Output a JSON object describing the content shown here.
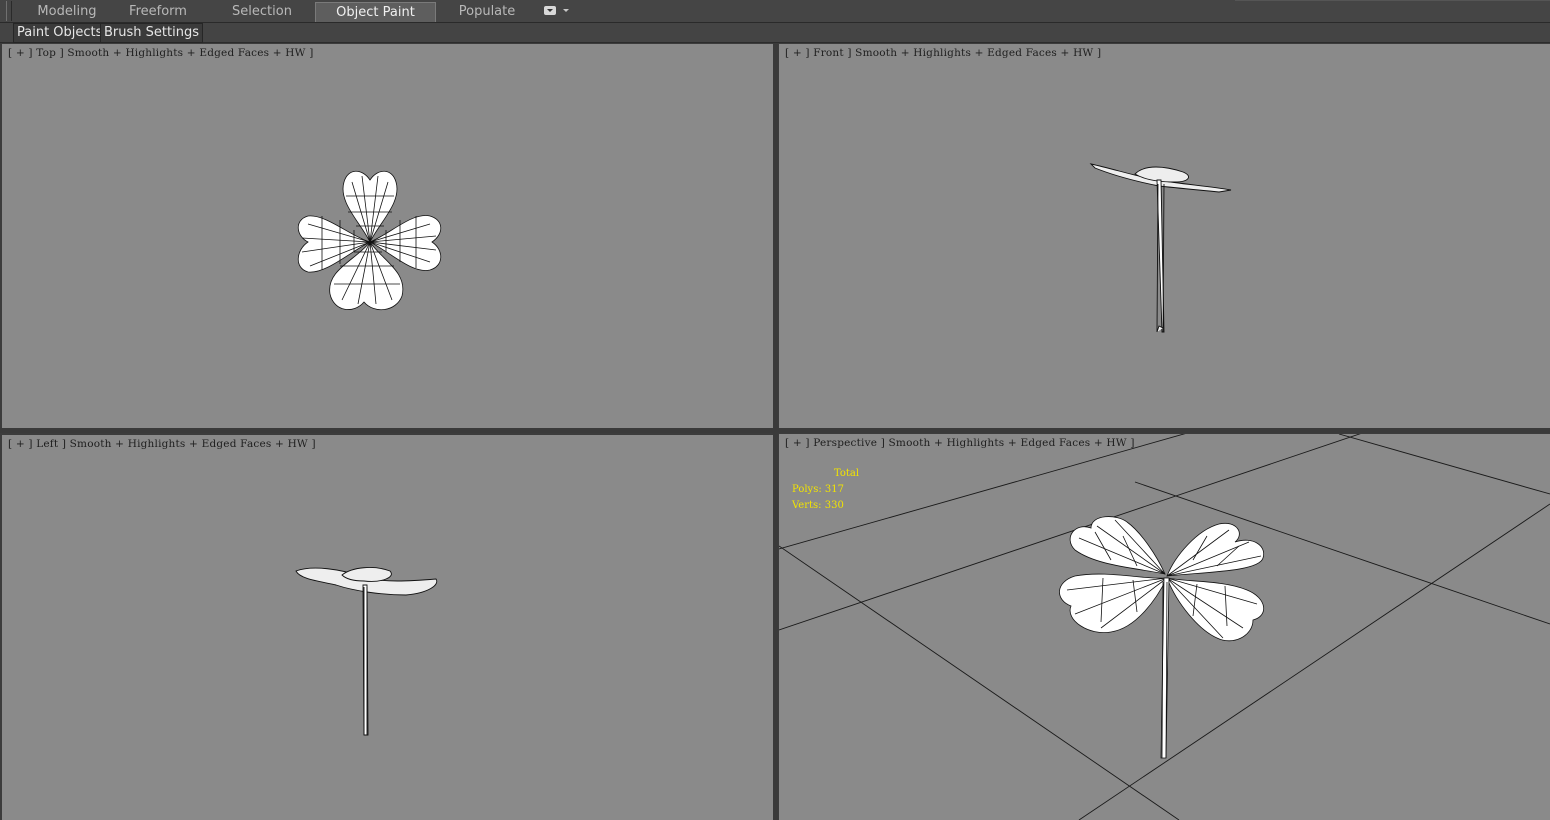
{
  "ribbon": {
    "tabs": [
      {
        "label": "Modeling",
        "active": false
      },
      {
        "label": "Freeform",
        "active": false
      },
      {
        "label": "Selection",
        "active": false
      },
      {
        "label": "Object Paint",
        "active": true
      },
      {
        "label": "Populate",
        "active": false
      }
    ]
  },
  "subtoolbar": {
    "paint_objects": "Paint Objects",
    "brush_settings": "Brush Settings"
  },
  "viewports": {
    "top": {
      "label": "[ + ] Top ] Smooth + Highlights + Edged Faces + HW ]"
    },
    "front": {
      "label": "[ + ] Front ] Smooth + Highlights + Edged Faces + HW ]"
    },
    "left": {
      "label": "[ + ] Left ] Smooth + Highlights + Edged Faces + HW ]"
    },
    "perspective": {
      "label": "[ + ] Perspective ] Smooth + Highlights + Edged Faces + HW ]",
      "stats": {
        "total_label": "Total",
        "polys_label": "Polys:",
        "polys_value": "317",
        "verts_label": "Verts:",
        "verts_value": "330"
      }
    }
  },
  "colors": {
    "viewport_bg": "#8a8a8a",
    "stats_text": "#f2e400",
    "ui_dark": "#3c3c3c"
  }
}
